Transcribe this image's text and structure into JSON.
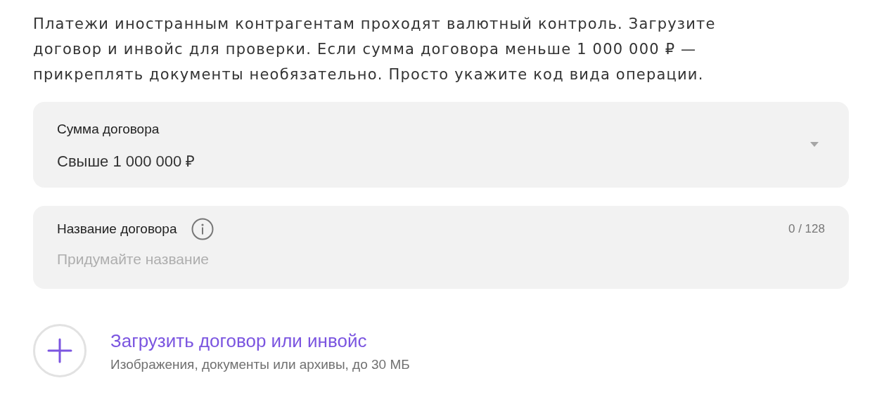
{
  "intro": "Платежи иностранным контрагентам проходят валютный контроль. Загрузите договор и инвойс для проверки. Если сумма договора меньше 1 000 000 ₽ — прикреплять документы необязательно. Просто укажите код вида операции.",
  "fields": [
    {
      "kind": "select",
      "label": "Сумма договора",
      "value": "Свыше 1 000 000 ₽"
    },
    {
      "kind": "text",
      "label": "Название договора",
      "info": true,
      "placeholder": "Придумайте название",
      "counter": "0 / 128"
    }
  ],
  "upload": {
    "title": "Загрузить договор или инвойс",
    "hint": "Изображения, документы или архивы, до 30 МБ"
  }
}
